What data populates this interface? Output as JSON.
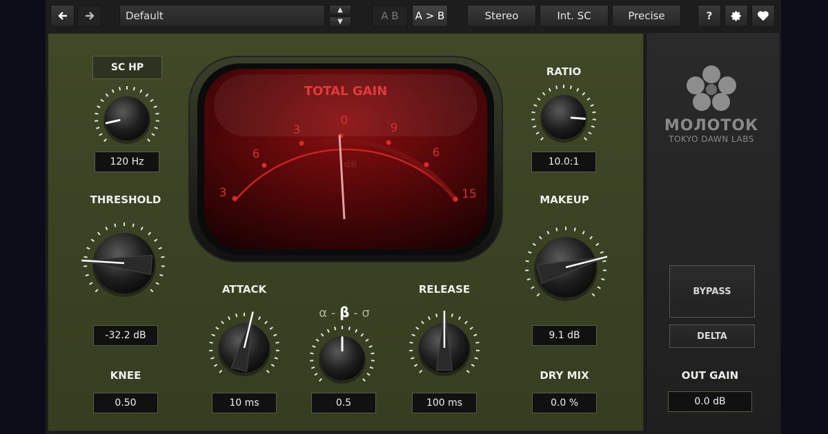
{
  "toolbar": {
    "back_icon": "arrow-left-icon",
    "forward_icon": "arrow-right-icon",
    "preset": "Default",
    "ab": "A B",
    "a_to_b": "A > B",
    "stereo": "Stereo",
    "int_sc": "Int. SC",
    "precise": "Precise",
    "help": "?",
    "settings_icon": "gear-icon",
    "favorite_icon": "heart-icon"
  },
  "meter": {
    "title": "TOTAL GAIN",
    "scale": [
      "3",
      "6",
      "3",
      "0",
      "9",
      "6",
      "15"
    ],
    "unit": "dB",
    "reading_db": 0
  },
  "controls": {
    "sc_hp": {
      "button": "SC HP",
      "value": "120 Hz",
      "level": 0.12
    },
    "threshold": {
      "label": "THRESHOLD",
      "value": "-32.2 dB",
      "level": 0.18
    },
    "knee": {
      "label": "KNEE",
      "value": "0.50"
    },
    "attack": {
      "label": "ATTACK",
      "value": "10 ms",
      "level": 0.55
    },
    "character": {
      "alpha": "α",
      "beta": "β",
      "sigma": "σ",
      "value": "0.5",
      "level": 0.5
    },
    "release": {
      "label": "RELEASE",
      "value": "100 ms",
      "level": 0.5
    },
    "ratio": {
      "label": "RATIO",
      "value": "10.0:1",
      "level": 0.85
    },
    "makeup": {
      "label": "MAKEUP",
      "value": "9.1 dB",
      "level": 0.78
    },
    "dry_mix": {
      "label": "DRY MIX",
      "value": "0.0 %"
    },
    "out_gain": {
      "label": "OUT GAIN",
      "value": "0.0 dB"
    }
  },
  "side": {
    "brand": "МОЛОТОК",
    "maker": "TOKYO DAWN LABS",
    "logo_icon": "flower-logo-icon",
    "bypass": "BYPASS",
    "delta": "DELTA"
  },
  "colors": {
    "panel": "#3d4424",
    "meter_red": "#e23a3a",
    "text": "#eeeeea"
  }
}
